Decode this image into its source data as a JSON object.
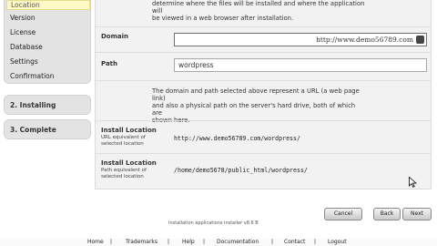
{
  "sidebar": {
    "step1_items": [
      "Location",
      "Version",
      "License",
      "Database",
      "Settings",
      "Confirmation"
    ],
    "step2_title": "2. Installing",
    "step3_title": "3. Complete"
  },
  "panel": {
    "intro_line1": "determine where the files will be installed and where the application will",
    "intro_line2": "be viewed in a web browser after installation.",
    "domain_label": "Domain",
    "domain_value": "http://www.demo56789.com",
    "path_label": "Path",
    "path_value": "wordpress",
    "explain_line1": "The domain and path selected above represent a URL (a web page link)",
    "explain_line2": "and also a physical path on the server's hard drive, both of which are",
    "explain_line3": "shown here.",
    "url_loc_title": "Install Location",
    "url_loc_sub1": "URL equivalent of",
    "url_loc_sub2": "selected location",
    "url_loc_value": "http://www.demo56789.com/wordpress/",
    "path_loc_title": "Install Location",
    "path_loc_sub1": "Path equivalent of",
    "path_loc_sub2": "selected location",
    "path_loc_value": "/home/demo5678/public_html/wordpress/"
  },
  "footer": {
    "version_text": "Installation applications installer v8.6 B",
    "cancel": "Cancel",
    "back": "Back",
    "next": "Next",
    "links": [
      "Home",
      "Trademarks",
      "Help",
      "Documentation",
      "Contact",
      "Logout"
    ],
    "separator": "|"
  },
  "colors": {
    "active_item_bg": "#fff9c8",
    "step_box_bg": "#e3e3e3",
    "panel_bg": "#f2f2f2"
  }
}
